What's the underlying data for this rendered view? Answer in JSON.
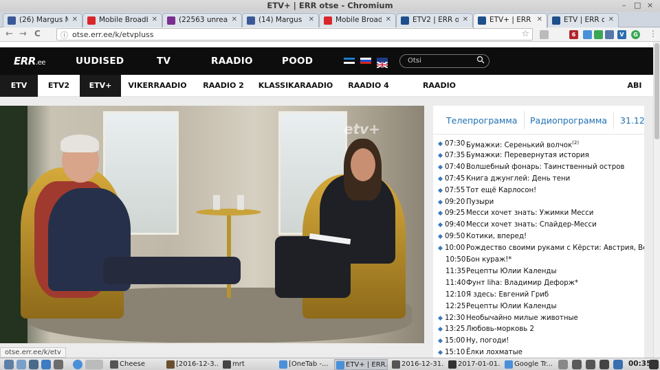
{
  "window": {
    "title": "ETV+ | ERR otse - Chromium",
    "controls": [
      "–",
      "□",
      "×"
    ]
  },
  "tabs": [
    {
      "label": "(26) Margus M",
      "icon_color": "#3b5998",
      "active": false
    },
    {
      "label": "Mobile Broadba",
      "icon_color": "#d9262c",
      "active": false
    },
    {
      "label": "(22563 unread)",
      "icon_color": "#7a2e8e",
      "active": false
    },
    {
      "label": "(14) Margus M",
      "icon_color": "#3b5998",
      "active": false
    },
    {
      "label": "Mobile Broadba",
      "icon_color": "#d9262c",
      "active": false
    },
    {
      "label": "ETV2 | ERR ots",
      "icon_color": "#1e4f8a",
      "active": false
    },
    {
      "label": "ETV+ | ERR o",
      "icon_color": "#1e4f8a",
      "active": true
    },
    {
      "label": "ETV | ERR ots",
      "icon_color": "#1e4f8a",
      "active": false
    }
  ],
  "toolbar": {
    "back": "←",
    "forward": "→",
    "reload": "C",
    "info": "ⓘ",
    "url": "otse.err.ee/k/etvpluss",
    "star": "☆",
    "menu": "⋮"
  },
  "extensions": [
    {
      "text": "",
      "color": "#bbbbbb"
    },
    {
      "text": "6",
      "color": "#b1262c"
    },
    {
      "text": "",
      "color": "#4a90d9"
    },
    {
      "text": "",
      "color": "#3aa757"
    },
    {
      "text": "",
      "color": "#5577aa"
    },
    {
      "text": "V",
      "color": "#2b6cb0"
    },
    {
      "text": "G",
      "color": "#34a853"
    },
    {
      "text": "",
      "color": "#aaaaaa"
    }
  ],
  "err": {
    "logo": "ERR",
    "logo_suffix": ".ee",
    "nav": [
      "UUDISED",
      "TV",
      "RAADIO",
      "POOD"
    ],
    "search_placeholder": "Otsi",
    "subnav": [
      "ETV",
      "ETV2",
      "ETV+",
      "VIKERRAADIO",
      "RAADIO 2",
      "KLASSIKARAADIO",
      "RAADIO 4",
      "RAADIO TALLINN",
      "ABI"
    ]
  },
  "video": {
    "watermark": "etv+"
  },
  "status_tip": "otse.err.ee/k/etv",
  "schedule": {
    "tab_tv": "Телепрограмма",
    "tab_radio": "Радиопрограмма",
    "date": "31.12",
    "items": [
      {
        "time": "07:30",
        "title": "Бумажки: Серенький волчок",
        "sup": "(2)",
        "bullet": true
      },
      {
        "time": "07:35",
        "title": "Бумажки: Перевернутая история",
        "sup": "",
        "bullet": true
      },
      {
        "time": "07:40",
        "title": "Волшебный фонарь: Таинственный остров",
        "sup": "",
        "bullet": true
      },
      {
        "time": "07:45",
        "title": "Книга джунглей: День тени",
        "sup": "",
        "bullet": true
      },
      {
        "time": "07:55",
        "title": "Тот ещё Карлосон!",
        "sup": "",
        "bullet": true
      },
      {
        "time": "09:20",
        "title": "Пузыри",
        "sup": "",
        "bullet": true
      },
      {
        "time": "09:25",
        "title": "Месси хочет знать: Ужимки Месси",
        "sup": "",
        "bullet": true
      },
      {
        "time": "09:40",
        "title": "Месси хочет знать: Спайдер-Месси",
        "sup": "",
        "bullet": true
      },
      {
        "time": "09:50",
        "title": "Котики, вперед!",
        "sup": "",
        "bullet": true
      },
      {
        "time": "10:00",
        "title": "Рождество своими руками с Кёрсти: Австрия, Вена",
        "sup": "",
        "bullet": true
      },
      {
        "time": "10:50",
        "title": "Бон кураж!*",
        "sup": "",
        "bullet": false
      },
      {
        "time": "11:35",
        "title": "Рецепты Юлии Календы",
        "sup": "",
        "bullet": false
      },
      {
        "time": "11:40",
        "title": "Фунт liha: Владимир Дефорж*",
        "sup": "",
        "bullet": false
      },
      {
        "time": "12:10",
        "title": "Я здесь: Евгений Гриб",
        "sup": "",
        "bullet": false
      },
      {
        "time": "12:25",
        "title": "Рецепты Юлии Календы",
        "sup": "",
        "bullet": false
      },
      {
        "time": "12:30",
        "title": "Необычайно милые животные",
        "sup": "",
        "bullet": true
      },
      {
        "time": "13:25",
        "title": "Любовь-морковь 2",
        "sup": "",
        "bullet": true
      },
      {
        "time": "15:00",
        "title": "Ну, погоди!",
        "sup": "",
        "bullet": true
      },
      {
        "time": "15:10",
        "title": "Ёлки лохматые",
        "sup": "",
        "bullet": true
      }
    ]
  },
  "taskbar": {
    "items": [
      {
        "label": "Cheese",
        "icon_color": "#555555",
        "pressed": false
      },
      {
        "label": "[2016-12-3...",
        "icon_color": "#6b4e2e",
        "pressed": false
      },
      {
        "label": "mrt",
        "icon_color": "#444444",
        "pressed": false
      },
      {
        "label": "[OneTab -...",
        "icon_color": "#4a90d9",
        "pressed": false
      },
      {
        "label": "ETV+ | ERR...",
        "icon_color": "#4a90d9",
        "pressed": true
      },
      {
        "label": "2016-12-31...",
        "icon_color": "#555555",
        "pressed": false
      },
      {
        "label": "2017-01-01...",
        "icon_color": "#333333",
        "pressed": false
      },
      {
        "label": "Google Tr...",
        "icon_color": "#4a90d9",
        "pressed": false
      }
    ],
    "clock": "00:35"
  }
}
